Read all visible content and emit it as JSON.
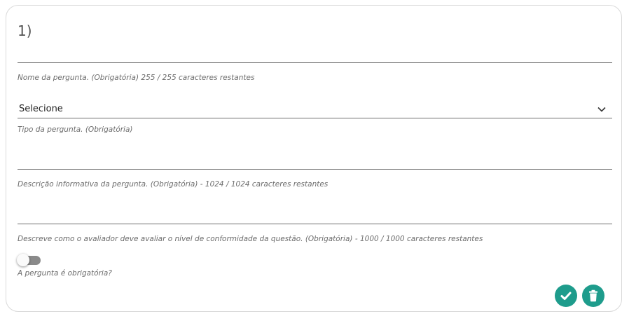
{
  "question": {
    "number_label": "1)",
    "name_helper": "Nome da pergunta. (Obrigatória) 255 / 255 caracteres restantes",
    "type_select": {
      "selected_value": "Selecione",
      "helper": "Tipo da pergunta. (Obrigatória)"
    },
    "description_helper": "Descrição informativa da pergunta. (Obrigatória) - 1024 / 1024 caracteres restantes",
    "evaluation_helper": "Descreve como o avaliador deve avaliar o nível de conformidade da questão. (Obrigatória) - 1000 / 1000 caracteres restantes",
    "required_toggle": {
      "label": "A pergunta é obrigatória?",
      "checked": false
    }
  },
  "actions": {
    "confirm_icon": "check-icon",
    "delete_icon": "trash-icon"
  },
  "colors": {
    "accent": "#1e9c8c",
    "border": "#d9d9d9",
    "underline": "#6e6e6e",
    "helper_text": "#6b6b6b"
  }
}
